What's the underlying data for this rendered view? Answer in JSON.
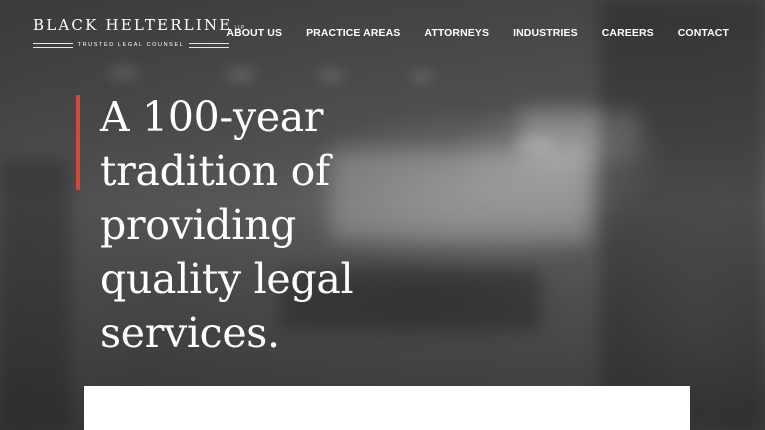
{
  "brand": {
    "name": "BLACK HELTERLINE",
    "suffix": "LLP",
    "tagline": "TRUSTED LEGAL COUNSEL"
  },
  "nav": {
    "items": [
      {
        "label": "ABOUT US"
      },
      {
        "label": "PRACTICE AREAS"
      },
      {
        "label": "ATTORNEYS"
      },
      {
        "label": "INDUSTRIES"
      },
      {
        "label": "CAREERS"
      },
      {
        "label": "CONTACT"
      }
    ]
  },
  "hero": {
    "headline": "A 100-year tradition of providing quality legal services."
  },
  "colors": {
    "accent": "#d9463a",
    "text": "#ffffff",
    "card": "#ffffff"
  }
}
